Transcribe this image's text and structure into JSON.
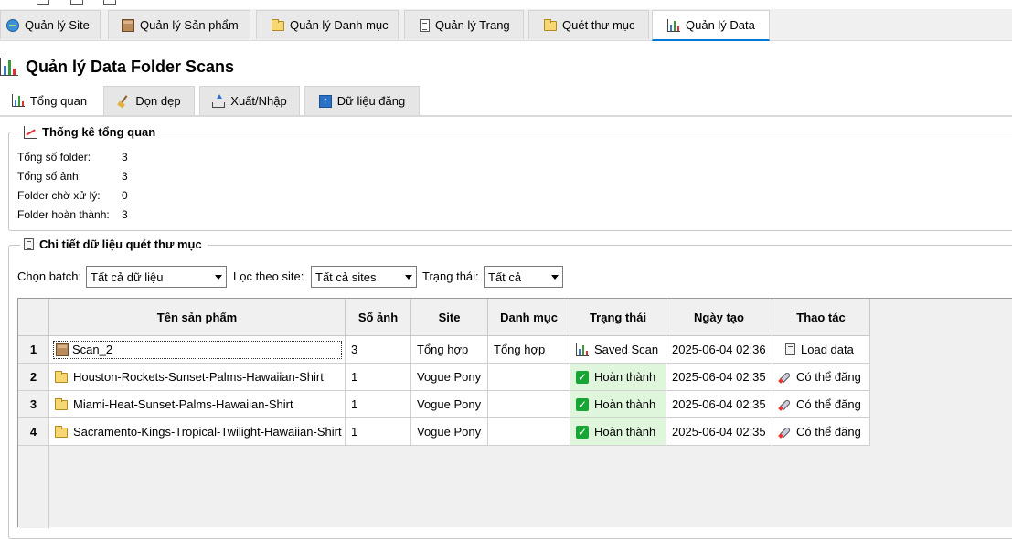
{
  "main_tabs": [
    {
      "label": "Quản lý Site",
      "icon": "globe-icon"
    },
    {
      "label": "Quản lý Sản phẩm",
      "icon": "box-icon"
    },
    {
      "label": "Quản lý Danh mục",
      "icon": "folder-icon"
    },
    {
      "label": "Quản lý Trang",
      "icon": "page-icon"
    },
    {
      "label": "Quét thư mục",
      "icon": "folder-icon"
    },
    {
      "label": "Quản lý Data",
      "icon": "chart-icon",
      "active": true
    }
  ],
  "page_title": "Quản lý Data Folder Scans",
  "sub_tabs": [
    {
      "label": "Tổng quan",
      "icon": "chart-icon",
      "active": true
    },
    {
      "label": "Dọn dẹp",
      "icon": "broom-icon"
    },
    {
      "label": "Xuất/Nhập",
      "icon": "upload-tray-icon"
    },
    {
      "label": "Dữ liệu đăng",
      "icon": "up-arrow-icon"
    }
  ],
  "overview": {
    "title": "Thống kê tổng quan",
    "stats": [
      {
        "label": "Tổng số folder:",
        "value": "3"
      },
      {
        "label": "Tổng số ảnh:",
        "value": "3"
      },
      {
        "label": "Folder chờ xử lý:",
        "value": "0"
      },
      {
        "label": "Folder hoàn thành:",
        "value": "3"
      }
    ]
  },
  "details": {
    "title": "Chi tiết dữ liệu quét thư mục",
    "filters": {
      "batch_label": "Chọn batch:",
      "batch_value": "Tất cả dữ liệu",
      "site_label": "Lọc theo site:",
      "site_value": "Tất cả sites",
      "status_label": "Trạng thái:",
      "status_value": "Tất cả"
    },
    "columns": [
      "Tên sản phẩm",
      "Số ảnh",
      "Site",
      "Danh mục",
      "Trạng thái",
      "Ngày tạo",
      "Thao tác"
    ],
    "rows": [
      {
        "num": "1",
        "name": "Scan_2",
        "name_icon": "box-icon",
        "images": "3",
        "site": "Tổng hợp",
        "category": "Tổng hợp",
        "status": "Saved Scan",
        "status_icon": "chart-icon",
        "created": "2025-06-04 02:36",
        "action": "Load data",
        "action_icon": "memo-icon"
      },
      {
        "num": "2",
        "name": "Houston-Rockets-Sunset-Palms-Hawaiian-Shirt",
        "name_icon": "folder-icon",
        "images": "1",
        "site": "Vogue Pony",
        "category": "",
        "status": "Hoàn thành",
        "status_icon": "check-icon",
        "created": "2025-06-04 02:35",
        "action": "Có thể đăng",
        "action_icon": "rocket-icon"
      },
      {
        "num": "3",
        "name": "Miami-Heat-Sunset-Palms-Hawaiian-Shirt",
        "name_icon": "folder-icon",
        "images": "1",
        "site": "Vogue Pony",
        "category": "",
        "status": "Hoàn thành",
        "status_icon": "check-icon",
        "created": "2025-06-04 02:35",
        "action": "Có thể đăng",
        "action_icon": "rocket-icon"
      },
      {
        "num": "4",
        "name": "Sacramento-Kings-Tropical-Twilight-Hawaiian-Shirt",
        "name_icon": "folder-icon",
        "images": "1",
        "site": "Vogue Pony",
        "category": "",
        "status": "Hoàn thành",
        "status_icon": "check-icon",
        "created": "2025-06-04 02:35",
        "action": "Có thể đăng",
        "action_icon": "rocket-icon"
      }
    ]
  },
  "colors": {
    "accent": "#0078d7",
    "done_bg": "#dff5dc",
    "done_check": "#19a535"
  }
}
